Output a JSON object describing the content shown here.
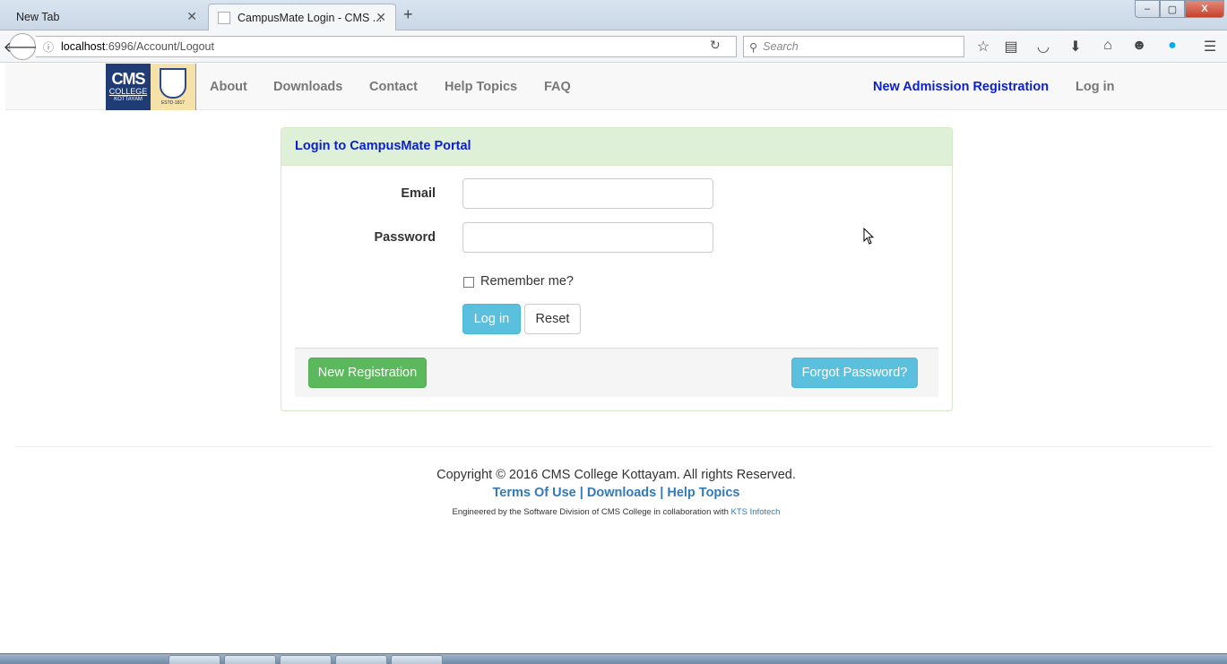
{
  "browser": {
    "tabs": [
      {
        "label": "New Tab",
        "active": false
      },
      {
        "label": "CampusMate Login - CMS ...",
        "active": true
      }
    ],
    "url_host": "localhost",
    "url_rest": ":6996/Account/Logout",
    "search_placeholder": "Search",
    "window_controls": {
      "minimize": "–",
      "maximize": "▢",
      "close": "X"
    }
  },
  "site_nav": {
    "logo": {
      "line1": "CMS",
      "line2": "COLLEGE",
      "line3": "KOTTAYAM",
      "estd": "ESTD-1817"
    },
    "links": [
      "About",
      "Downloads",
      "Contact",
      "Help Topics",
      "FAQ"
    ],
    "right_links": {
      "admission": "New Admission Registration",
      "login": "Log in"
    }
  },
  "login_panel": {
    "heading": "Login to CampusMate Portal",
    "email_label": "Email",
    "email_value": "",
    "password_label": "Password",
    "password_value": "",
    "remember_label": "Remember me?",
    "remember_checked": false,
    "login_button": "Log in",
    "reset_button": "Reset",
    "new_registration_button": "New Registration",
    "forgot_password_button": "Forgot Password?"
  },
  "footer": {
    "copyright": "Copyright © 2016 CMS College Kottayam. All rights Reserved.",
    "links": [
      "Terms Of Use",
      "Downloads",
      "Help Topics"
    ],
    "separator": " | ",
    "engineered_text": "Engineered by the Software Division of CMS College in collaboration with ",
    "engineered_link": "KTS Infotech"
  },
  "colors": {
    "panel_heading_bg": "#dff0d8",
    "link_blue": "#0b1fcc",
    "info_button": "#5bc0de",
    "success_button": "#5cb85c"
  }
}
